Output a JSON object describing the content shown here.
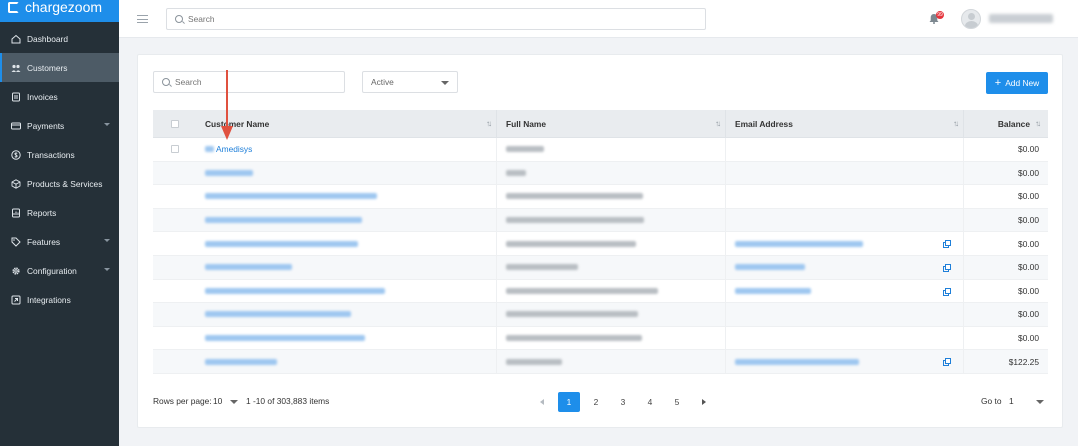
{
  "app": {
    "logo_text": "chargezoom"
  },
  "sidebar": {
    "items": [
      {
        "label": "Dashboard",
        "icon": "home-icon"
      },
      {
        "label": "Customers",
        "icon": "users-icon"
      },
      {
        "label": "Invoices",
        "icon": "invoice-icon"
      },
      {
        "label": "Payments",
        "icon": "card-icon"
      },
      {
        "label": "Transactions",
        "icon": "dollar-icon"
      },
      {
        "label": "Products & Services",
        "icon": "box-icon"
      },
      {
        "label": "Reports",
        "icon": "report-icon"
      },
      {
        "label": "Features",
        "icon": "tag-icon"
      },
      {
        "label": "Configuration",
        "icon": "gear-icon"
      },
      {
        "label": "Integrations",
        "icon": "plug-icon"
      }
    ]
  },
  "topbar": {
    "search_placeholder": "Search",
    "notification_count": "99"
  },
  "toolbar": {
    "search_placeholder": "Search",
    "status_value": "Active",
    "add_label": "Add New"
  },
  "table": {
    "columns": [
      "Customer Name",
      "Full Name",
      "Email Address",
      "Balance"
    ],
    "first_customer": "Amedisys",
    "balances": [
      "$0.00",
      "$0.00",
      "$0.00",
      "$0.00",
      "$0.00",
      "$0.00",
      "$0.00",
      "$0.00",
      "$0.00",
      "$122.25"
    ]
  },
  "footer": {
    "rows_per_page_label": "Rows per page:",
    "rows_per_page_value": "10",
    "range_text": "1 -10 of 303,883  items",
    "pages": [
      "1",
      "2",
      "3",
      "4",
      "5"
    ],
    "goto_label": "Go to",
    "goto_value": "1"
  },
  "colors": {
    "accent": "#1e8eea",
    "sidebar": "#253038",
    "badge": "#e5343c",
    "arrow": "#e0513f"
  }
}
